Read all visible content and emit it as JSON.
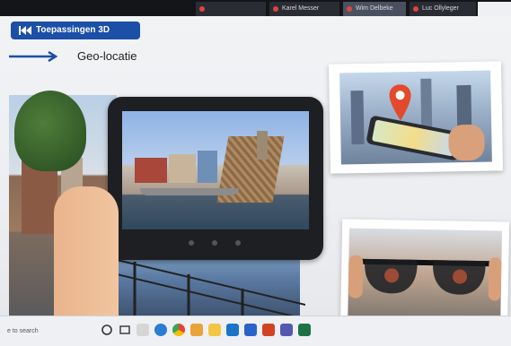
{
  "call": {
    "participants": [
      {
        "name": "Karel Messer",
        "state": "muted"
      },
      {
        "name": "Wim Delbeke",
        "state": "muted"
      },
      {
        "name": "Luc Ollyleger",
        "state": "muted"
      }
    ]
  },
  "slide": {
    "badge_label": "Toepassingen 3D",
    "subtitle": "Geo-locatie"
  },
  "taskbar": {
    "search_placeholder": "e to search",
    "icons": [
      "windows-start",
      "task-view",
      "taskbar-app",
      "edge-browser",
      "chrome-browser",
      "photos-app",
      "file-explorer",
      "outlook",
      "powerpoint",
      "teams",
      "excel"
    ]
  },
  "colors": {
    "badge": "#1b4fa8",
    "arrow": "#1b4fa8",
    "pin": "#e24a2b"
  }
}
